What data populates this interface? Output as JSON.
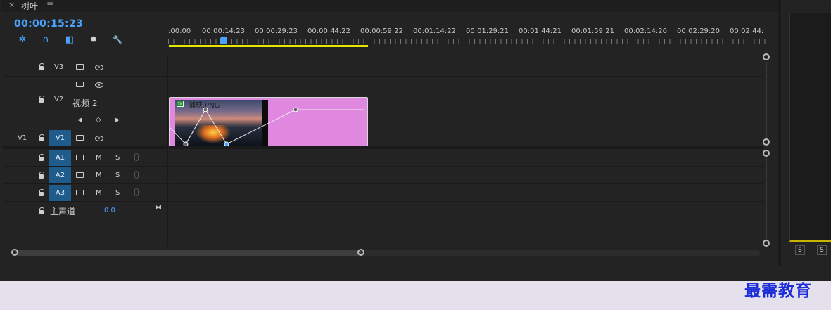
{
  "panel": {
    "close_glyph": "×",
    "sequence_name": "树叶",
    "menu_glyph": "≡",
    "timecode": "00:00:15:23"
  },
  "toolbar": {
    "icons": [
      "insert-nest-icon",
      "snap-magnet-icon",
      "linked-selection-icon",
      "marker-icon",
      "wrench-icon"
    ],
    "glyphs": [
      "✲",
      "∩",
      "◧",
      "⬟",
      "🔧"
    ]
  },
  "ruler": {
    "labels": [
      ":00:00",
      "00:00:14:23",
      "00:00:29:23",
      "00:00:44:22",
      "00:00:59:22",
      "00:01:14:22",
      "00:01:29:21",
      "00:01:44:21",
      "00:01:59:21",
      "00:02:14:20",
      "00:02:29:20",
      "00:02:44:"
    ]
  },
  "tracks": {
    "v3": {
      "name": "V3"
    },
    "v2": {
      "name": "V2",
      "display_name": "视频 2"
    },
    "v1": {
      "source": "V1",
      "name": "V1"
    },
    "a1": {
      "name": "A1",
      "m": "M",
      "s": "S"
    },
    "a2": {
      "name": "A2",
      "m": "M",
      "s": "S"
    },
    "a3": {
      "name": "A3",
      "m": "M",
      "s": "S"
    },
    "master": {
      "name": "主声道",
      "value": "0.0"
    }
  },
  "keyframe_nav": {
    "prev": "◀",
    "add": "◇",
    "next": "▶"
  },
  "clip": {
    "name": "捕获.PNG",
    "fx_badge": "fx"
  },
  "right_panel": {
    "solo_a": "S",
    "solo_b": "S"
  },
  "watermark": "最需教育",
  "colors": {
    "accent": "#4aa3ff",
    "clip": "#e088e0",
    "work_area": "#e6e600",
    "track_target": "#1f5c8c"
  }
}
